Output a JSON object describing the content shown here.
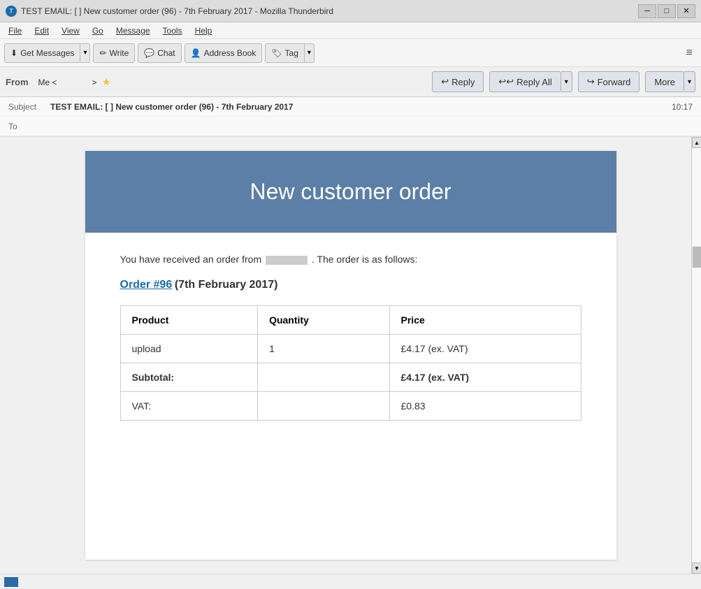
{
  "titlebar": {
    "title": "TEST EMAIL: [                    ] New customer order (96) - 7th February 2017 - Mozilla Thunderbird",
    "icon": "🦤",
    "minimize": "─",
    "maximize": "□",
    "close": "✕"
  },
  "menubar": {
    "items": [
      "File",
      "Edit",
      "View",
      "Go",
      "Message",
      "Tools",
      "Help"
    ]
  },
  "toolbar": {
    "get_messages": "Get Messages",
    "write": "Write",
    "chat": "Chat",
    "address_book": "Address Book",
    "tag": "Tag",
    "hamburger": "≡"
  },
  "action_bar": {
    "reply": "Reply",
    "reply_all": "Reply All",
    "forward": "Forward",
    "more": "More"
  },
  "email_header": {
    "from_label": "From",
    "from_value": "Me <                             >",
    "subject_label": "Subject",
    "subject_value": "TEST EMAIL: [                    ] New customer order (96) - 7th February 2017",
    "to_label": "To",
    "to_value": "",
    "time": "10:17"
  },
  "email_body": {
    "banner_title": "New customer order",
    "intro_text": "You have received an order from",
    "intro_suffix": ". The order is as follows:",
    "order_number": "Order #96",
    "order_date": "(7th February 2017)",
    "table_headers": [
      "Product",
      "Quantity",
      "Price"
    ],
    "table_rows": [
      {
        "product": "upload",
        "quantity": "1",
        "price": "£4.17 (ex. VAT)"
      }
    ],
    "subtotal_label": "Subtotal:",
    "subtotal_value": "£4.17 (ex. VAT)",
    "vat_label": "VAT:",
    "vat_value": "£0.83"
  },
  "statusbar": {}
}
